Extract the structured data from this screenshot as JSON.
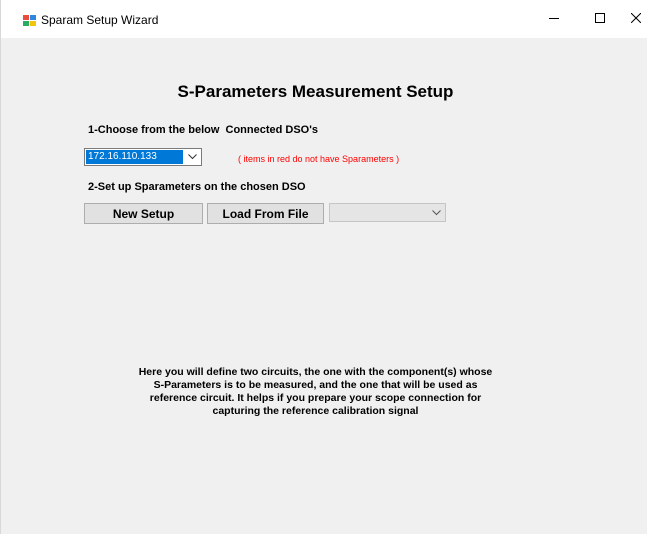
{
  "window": {
    "title": "Sparam Setup Wizard",
    "app_icon": "setup-wizard-icon",
    "controls": [
      "minimize-icon",
      "maximize-icon",
      "close-icon"
    ]
  },
  "main": {
    "heading": "S-Parameters Measurement Setup",
    "step1_label": "1-Choose from the below  Connected DSO's",
    "dso_select": {
      "value": "172.16.110.133"
    },
    "red_note": "( items in red do not have Sparameters )",
    "step2_label": "2-Set up Sparameters on the chosen DSO",
    "new_setup_label": "New Setup",
    "load_from_file_label": "Load From File",
    "file_select": {
      "value": ""
    },
    "description": "Here you will define two circuits, the one with the component(s) whose\nS-Parameters is to be measured, and the one that will be used as\nreference circuit. It helps if you prepare your scope connection for\ncapturing the reference calibration signal"
  },
  "colors": {
    "selection": "#0078d7",
    "note_text": "#ff0000",
    "window_bg": "#f0f0f0"
  }
}
